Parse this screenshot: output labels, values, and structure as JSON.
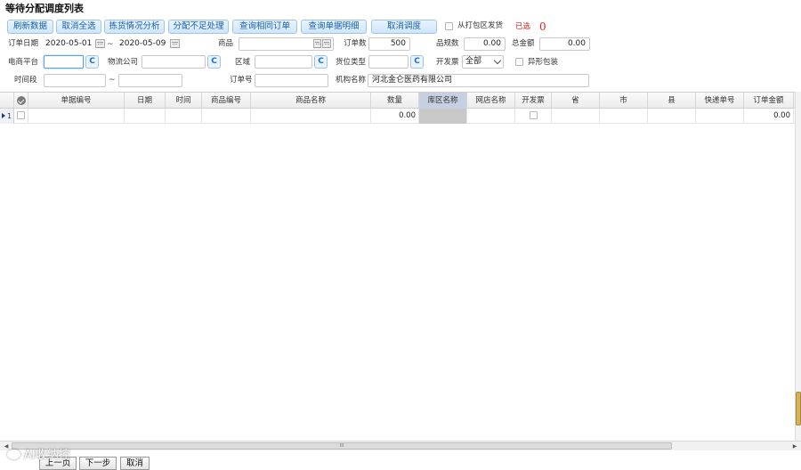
{
  "page_title": "等待分配调度列表",
  "toolbar": {
    "refresh": "刷新数据",
    "deselect_all": "取消全选",
    "picking_analysis": "拣货情况分析",
    "insufficient_allocation": "分配不足处理",
    "query_same_order": "查询相同订单",
    "query_document_detail": "查询单据明细",
    "cancel_dispatch": "取消调度"
  },
  "ship_from_pack_area": "从打包区发货",
  "selected_label": "已选",
  "selected_count": "0",
  "filters": {
    "order_date_label": "订单日期",
    "date_from": "2020-05-01",
    "date_to": "2020-05-09",
    "tilde": "~",
    "product_label": "商品",
    "product_value": "",
    "order_count_label": "订单数",
    "order_count_value": "500",
    "sku_count_label": "品规数",
    "sku_count_value": "0.00",
    "total_amount_label": "总金额",
    "total_amount_value": "0.00",
    "ecommerce_label": "电商平台",
    "ecommerce_value": "",
    "logistics_label": "物流公司",
    "logistics_value": "",
    "region_label": "区域",
    "region_value": "",
    "slot_type_label": "货位类型",
    "slot_type_value": "",
    "invoice_label": "开发票",
    "invoice_value": "全部",
    "irregular_pack_label": "异形包装",
    "time_range_label": "时间段",
    "time_from": "",
    "time_to": "",
    "order_no_label": "订单号",
    "order_no_value": "",
    "org_name_label": "机构名称",
    "org_name_value": "河北金仑医药有限公司",
    "clear_button": "C"
  },
  "grid": {
    "columns": [
      "单据编号",
      "日期",
      "时间",
      "商品编号",
      "商品名称",
      "数量",
      "库区名称",
      "网店名称",
      "开发票",
      "省",
      "市",
      "县",
      "快递单号",
      "订单金额"
    ],
    "rows": [
      {
        "row_number": "1",
        "doc_no": "",
        "date": "",
        "time": "",
        "product_code": "",
        "product_name": "",
        "quantity": "0.00",
        "area_name": "",
        "shop_name": "",
        "province": "",
        "city": "",
        "county": "",
        "express_no": "",
        "order_amount": "0.00"
      }
    ]
  },
  "hscroll_grip": "III",
  "pager": {
    "prev": "上一页",
    "next": "下一步",
    "cancel": "取消"
  },
  "watermark": "AI收纳控"
}
